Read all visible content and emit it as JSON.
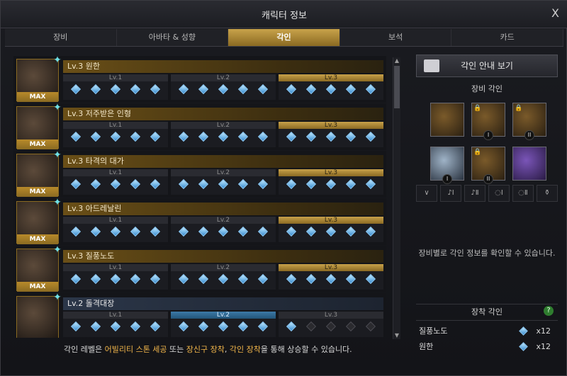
{
  "window": {
    "title": "캐릭터 정보",
    "close_label": "X"
  },
  "tabs": [
    {
      "label": "장비",
      "active": false
    },
    {
      "label": "아바타 & 성향",
      "active": false
    },
    {
      "label": "각인",
      "active": true
    },
    {
      "label": "보석",
      "active": false
    },
    {
      "label": "카드",
      "active": false
    }
  ],
  "engravings": [
    {
      "name": "Lv.3 원한",
      "badge": "MAX",
      "levels": [
        "Lv.1",
        "Lv.2",
        "Lv.3"
      ],
      "filled_points": 15
    },
    {
      "name": "Lv.3 저주받은 인형",
      "badge": "MAX",
      "levels": [
        "Lv.1",
        "Lv.2",
        "Lv.3"
      ],
      "filled_points": 15
    },
    {
      "name": "Lv.3 타격의 대가",
      "badge": "MAX",
      "levels": [
        "Lv.1",
        "Lv.2",
        "Lv.3"
      ],
      "filled_points": 15
    },
    {
      "name": "Lv.3 아드레날린",
      "badge": "MAX",
      "levels": [
        "Lv.1",
        "Lv.2",
        "Lv.3"
      ],
      "filled_points": 15
    },
    {
      "name": "Lv.3 질풍노도",
      "badge": "MAX",
      "levels": [
        "Lv.1",
        "Lv.2",
        "Lv.3"
      ],
      "filled_points": 15
    },
    {
      "name": "Lv.2 돌격대장",
      "badge": "",
      "levels": [
        "Lv.1",
        "Lv.2",
        "Lv.3"
      ],
      "filled_points": 11
    }
  ],
  "footer": {
    "text_before": "각인 레벨은 ",
    "highlight1": "어빌리티 스톤 세공",
    "text_mid1": " 또는 ",
    "highlight2": "장신구 장착",
    "text_mid2": ", ",
    "highlight3": "각인 장착",
    "text_after": "을 통해 상승할 수 있습니다."
  },
  "right_panel": {
    "guide_button": "각인 안내 보기",
    "equipment_title": "장비 각인",
    "equipment_items": [
      {
        "type": "necklace",
        "rank": ""
      },
      {
        "type": "earring",
        "rank": "I"
      },
      {
        "type": "earring",
        "rank": "II"
      },
      {
        "type": "ring",
        "rank": "I"
      },
      {
        "type": "ring",
        "rank": "II"
      },
      {
        "type": "stone",
        "rank": ""
      }
    ],
    "slot_icons": [
      "necklace-slot-icon",
      "earring-1-slot-icon",
      "earring-2-slot-icon",
      "ring-1-slot-icon",
      "ring-2-slot-icon",
      "stone-slot-icon"
    ],
    "equipment_message": "장비별로 각인 정보를 확인할 수 있습니다.",
    "installed_title": "장착 각인",
    "installed": [
      {
        "name": "질풍노도",
        "qty": "x12"
      },
      {
        "name": "원한",
        "qty": "x12"
      }
    ]
  }
}
